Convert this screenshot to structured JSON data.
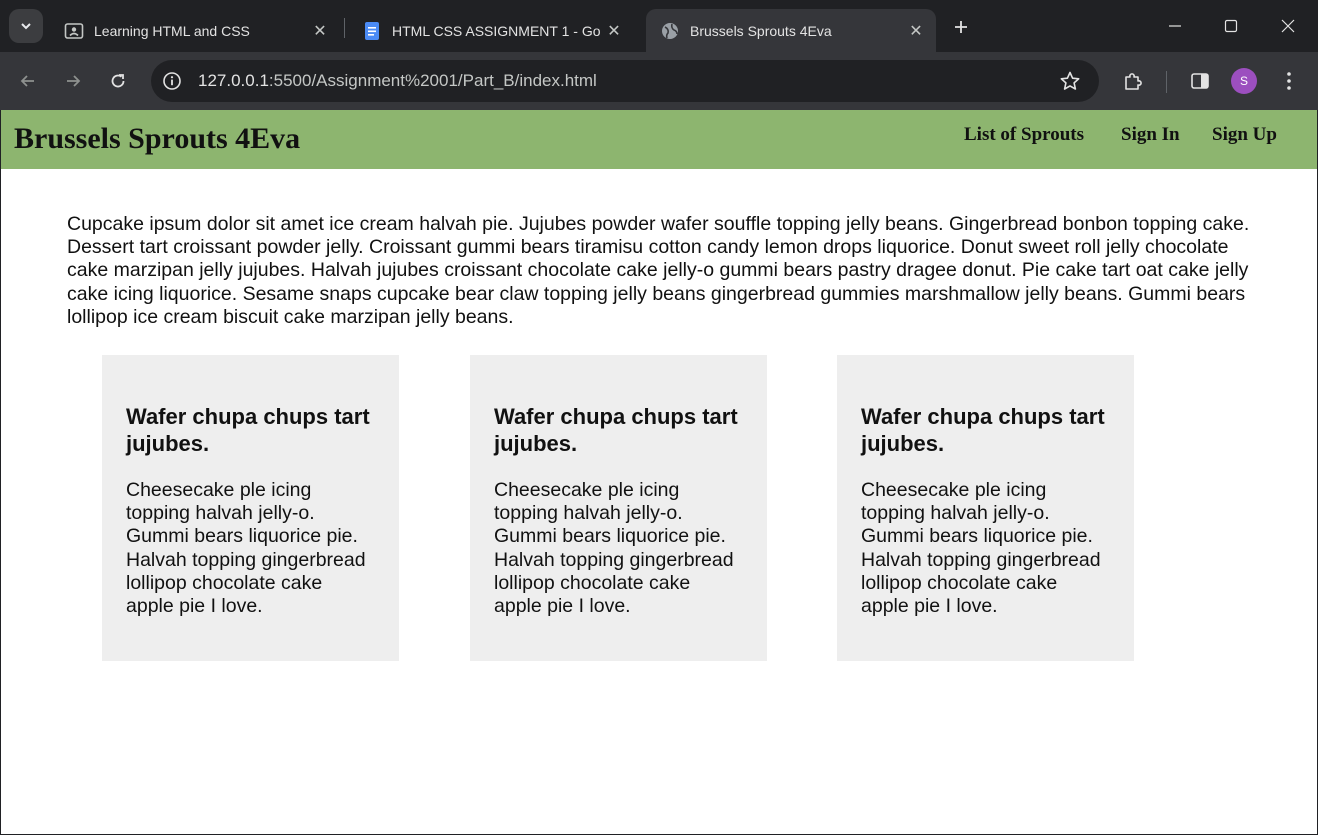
{
  "browser": {
    "tabs": [
      {
        "title": "Learning HTML and CSS",
        "icon": "classroom-icon",
        "active": false
      },
      {
        "title": "HTML CSS ASSIGNMENT 1 - Go",
        "icon": "docs-icon",
        "active": false
      },
      {
        "title": "Brussels Sprouts 4Eva",
        "icon": "globe-icon",
        "active": true
      }
    ],
    "url_host": "127.0.0.1",
    "url_rest": ":5500/Assignment%2001/Part_B/index.html",
    "profile_initial": "S",
    "profile_color": "#9c4fbf"
  },
  "site": {
    "title": "Brussels Sprouts 4Eva",
    "header_color": "#8db56f",
    "nav": [
      {
        "label": "List of Sprouts"
      },
      {
        "label": "Sign In"
      },
      {
        "label": "Sign Up"
      }
    ],
    "intro": "Cupcake ipsum dolor sit amet ice cream halvah pie. Jujubes powder wafer souffle topping jelly beans. Gingerbread bonbon topping cake. Dessert tart croissant powder jelly. Croissant gummi bears tiramisu cotton candy lemon drops liquorice. Donut sweet roll jelly chocolate cake marzipan jelly jujubes. Halvah jujubes croissant chocolate cake jelly-o gummi bears pastry dragee donut. Pie cake tart oat cake jelly cake icing liquorice. Sesame snaps cupcake bear claw topping jelly beans gingerbread gummies marshmallow jelly beans. Gummi bears lollipop ice cream biscuit cake marzipan jelly beans.",
    "cards": [
      {
        "heading": "Wafer chupa chups tart jujubes.",
        "body": "Cheesecake ple icing topping halvah jelly-o. Gummi bears liquorice pie. Halvah topping gingerbread lollipop chocolate cake apple pie I love."
      },
      {
        "heading": "Wafer chupa chups tart jujubes.",
        "body": "Cheesecake ple icing topping halvah jelly-o. Gummi bears liquorice pie. Halvah topping gingerbread lollipop chocolate cake apple pie I love."
      },
      {
        "heading": "Wafer chupa chups tart jujubes.",
        "body": "Cheesecake ple icing topping halvah jelly-o. Gummi bears liquorice pie. Halvah topping gingerbread lollipop chocolate cake apple pie I love."
      }
    ]
  }
}
